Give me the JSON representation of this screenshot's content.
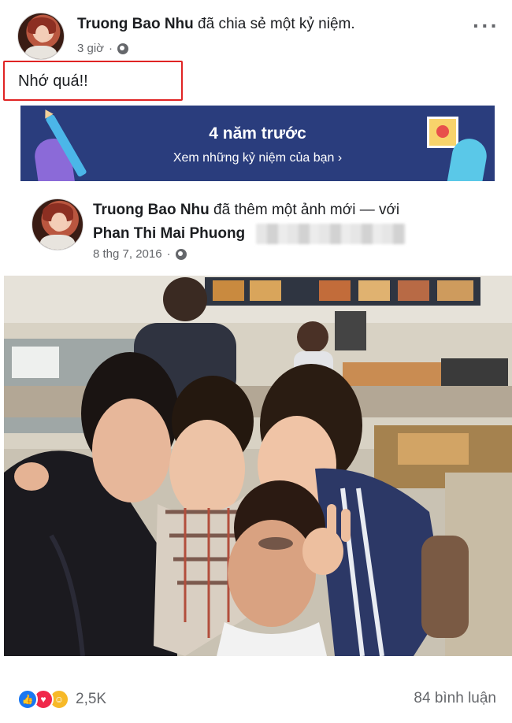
{
  "post": {
    "author": "Truong Bao Nhu",
    "action": "đã chia sẻ một kỷ niệm.",
    "time": "3 giờ",
    "privacy_icon": "globe-icon",
    "caption": "Nhớ quá!!"
  },
  "memory": {
    "title": "4 năm trước",
    "subtitle": "Xem những kỷ niệm của bạn ›",
    "background": "#2a3d7d"
  },
  "shared": {
    "author": "Truong Bao Nhu",
    "action": "đã thêm một ảnh mới — với",
    "tagged": "Phan Thi Mai Phuong",
    "date": "8 thg 7, 2016",
    "privacy_icon": "globe-icon"
  },
  "photo": {
    "description_icon": "group-selfie-photo"
  },
  "footer": {
    "reactions": [
      "like",
      "love",
      "care"
    ],
    "reaction_count": "2,5K",
    "comment_count": "84 bình luận"
  },
  "colors": {
    "highlight_border": "#e02424",
    "secondary_text": "#65676b",
    "like": "#1877f2",
    "love": "#f0284a",
    "care": "#f7b928"
  }
}
